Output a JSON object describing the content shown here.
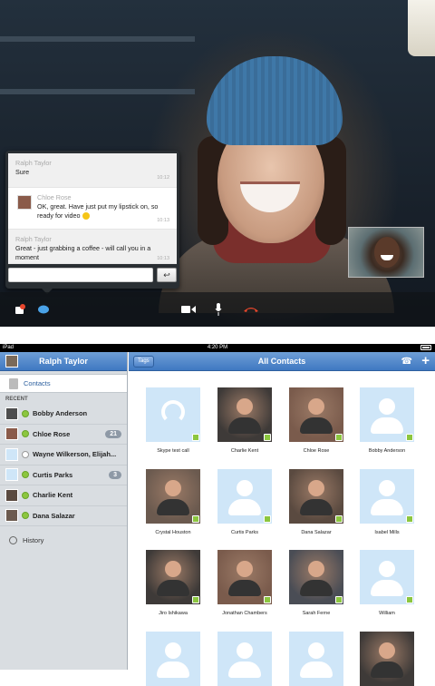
{
  "chat": {
    "messages": [
      {
        "sender": "Ralph Taylor",
        "text": "Sure",
        "time": "10:12"
      },
      {
        "sender": "Chloe Rose",
        "text": "OK, great. Have just put my lipstick on, so ready for video",
        "time": "10:13"
      },
      {
        "sender": "Ralph Taylor",
        "text": "Great - just grabbing a coffee - will call you in a moment",
        "time": "10:13"
      }
    ],
    "input_placeholder": "",
    "send_icon": "return-arrow-icon"
  },
  "call_toolbar": {
    "icons": [
      "chat-notification-icon",
      "chat-bubble-icon",
      "video-camera-icon",
      "microphone-icon",
      "hang-up-icon"
    ],
    "hangup_color": "#e8462c"
  },
  "status_bar": {
    "device": "iPad",
    "time": "4:20 PM"
  },
  "sidebar": {
    "title": "Ralph Taylor",
    "contacts_label": "Contacts",
    "recent_label": "RECENT",
    "recent": [
      {
        "name": "Bobby Anderson",
        "status": "online",
        "badge": ""
      },
      {
        "name": "Chloe Rose",
        "status": "online",
        "badge": "21"
      },
      {
        "name": "Wayne Wilkerson, Elijah...",
        "status": "offline",
        "badge": ""
      },
      {
        "name": "Curtis Parks",
        "status": "online",
        "badge": "3"
      },
      {
        "name": "Charlie Kent",
        "status": "online",
        "badge": ""
      },
      {
        "name": "Dana Salazar",
        "status": "online",
        "badge": ""
      }
    ],
    "history_label": "History"
  },
  "main": {
    "title": "All Contacts",
    "tags_label": "Tags",
    "contacts": [
      {
        "name": "Skype test call",
        "kind": "headset"
      },
      {
        "name": "Charlie Kent",
        "kind": "photo"
      },
      {
        "name": "Chloe Rose",
        "kind": "photo"
      },
      {
        "name": "Bobby Anderson",
        "kind": "placeholder"
      },
      {
        "name": "Crystal Houston",
        "kind": "photo"
      },
      {
        "name": "Curtis Parks",
        "kind": "placeholder"
      },
      {
        "name": "Dana Salazar",
        "kind": "photo"
      },
      {
        "name": "Isabel Mills",
        "kind": "placeholder"
      },
      {
        "name": "Jiro Ishikawa",
        "kind": "photo"
      },
      {
        "name": "Jonathan Chambers",
        "kind": "photo"
      },
      {
        "name": "Sarah Ferne",
        "kind": "photo"
      },
      {
        "name": "William",
        "kind": "placeholder"
      },
      {
        "name": "",
        "kind": "placeholder"
      },
      {
        "name": "",
        "kind": "placeholder"
      },
      {
        "name": "",
        "kind": "placeholder"
      },
      {
        "name": "",
        "kind": "photo"
      }
    ],
    "accent_color": "#3f78c2",
    "online_color": "#8cc63f"
  }
}
